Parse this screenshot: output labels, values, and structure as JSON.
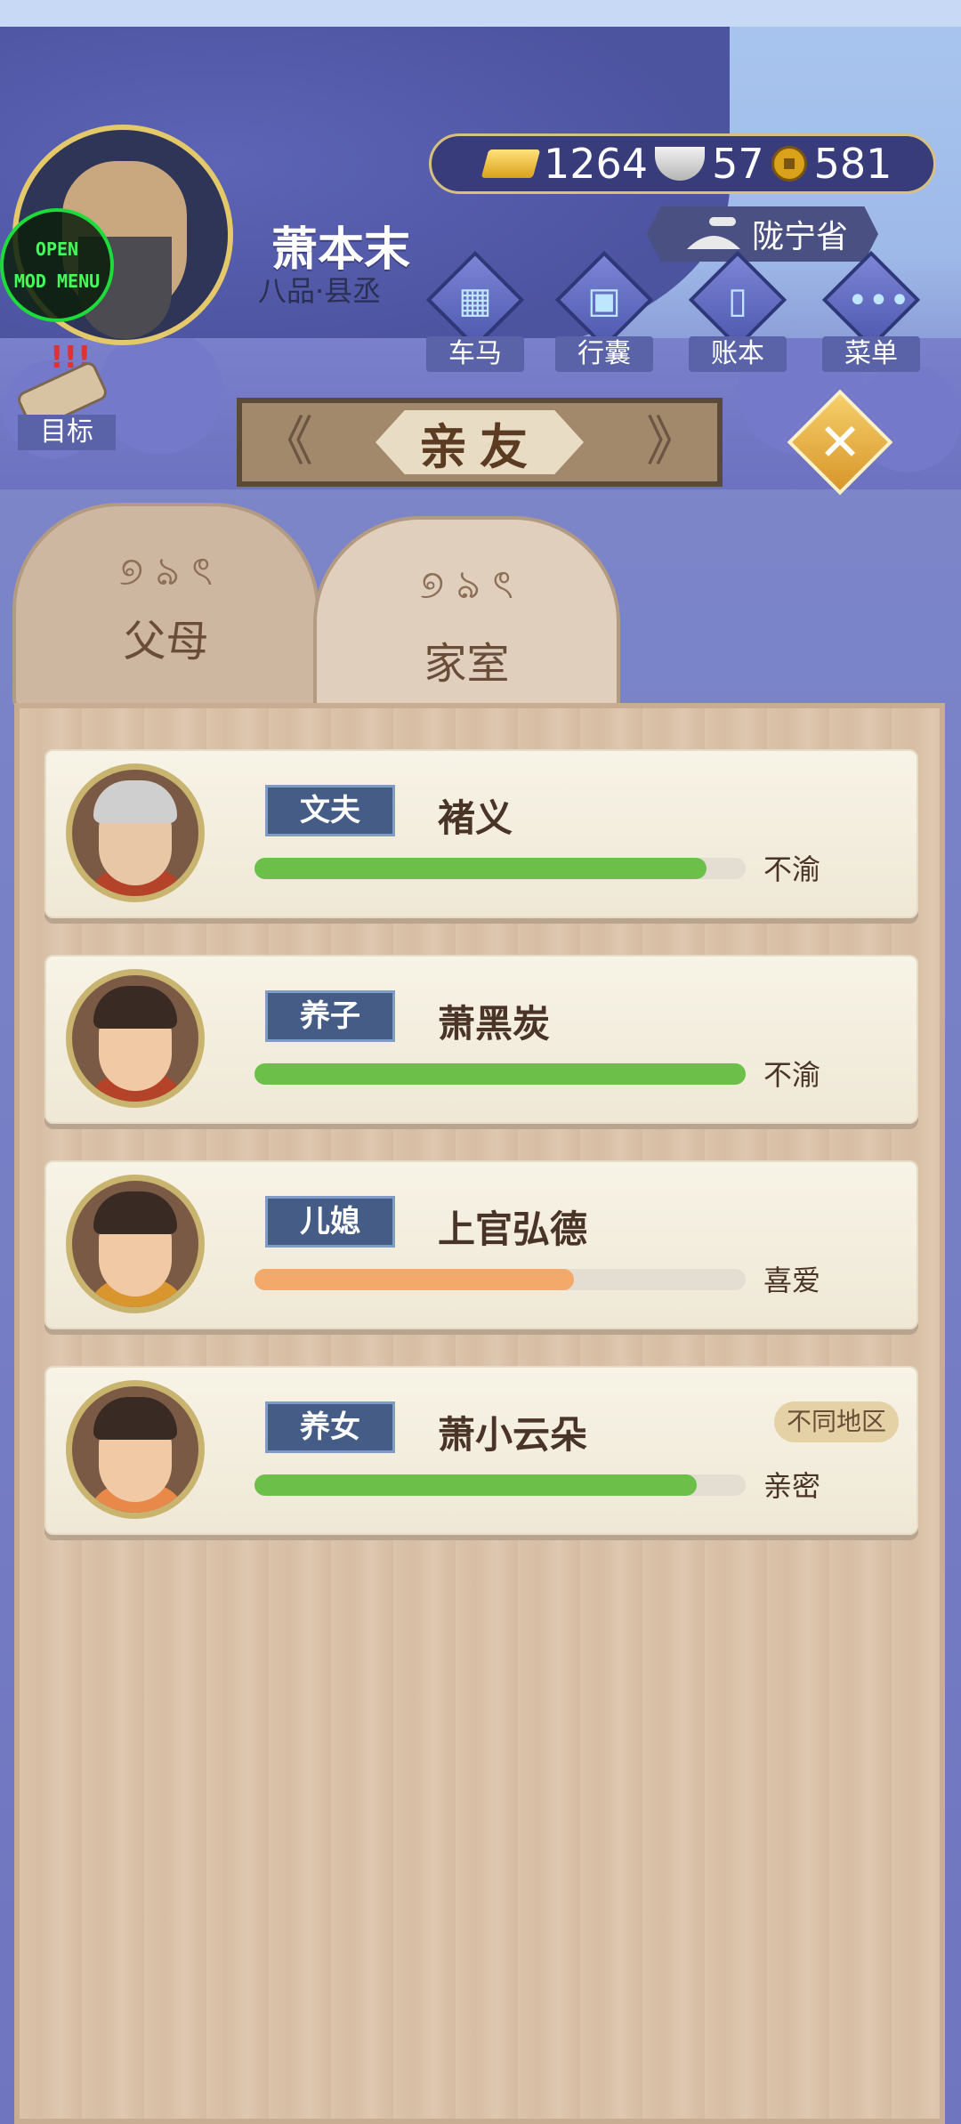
{
  "player": {
    "name": "萧本末",
    "rank": "八品·县丞"
  },
  "mod_menu": {
    "line1": "OPEN",
    "line2": "MOD MENU"
  },
  "currency": {
    "gold": "1264",
    "silver": "57",
    "coins": "581"
  },
  "province": "陇宁省",
  "menu": [
    {
      "label": "车马",
      "icon": "carriage-icon"
    },
    {
      "label": "行囊",
      "icon": "bag-icon"
    },
    {
      "label": "账本",
      "icon": "ledger-icon"
    },
    {
      "label": "菜单",
      "icon": "more-icon"
    }
  ],
  "target_label": "目标",
  "title": "亲友",
  "tabs": [
    {
      "label": "父母",
      "active": false
    },
    {
      "label": "家室",
      "active": true
    }
  ],
  "relatives": [
    {
      "relation": "文夫",
      "name": "褚义",
      "affinity": 0.92,
      "bar_color": "#6cc04a",
      "mood": "不渝",
      "badge": ""
    },
    {
      "relation": "养子",
      "name": "萧黑炭",
      "affinity": 1.0,
      "bar_color": "#6cc04a",
      "mood": "不渝",
      "badge": ""
    },
    {
      "relation": "儿媳",
      "name": "上官弘德",
      "affinity": 0.65,
      "bar_color": "#f2a96a",
      "mood": "喜爱",
      "badge": ""
    },
    {
      "relation": "养女",
      "name": "萧小云朵",
      "affinity": 0.9,
      "bar_color": "#6cc04a",
      "mood": "亲密",
      "badge": "不同地区"
    }
  ],
  "colors": {
    "banner": "#4c539f",
    "accent_gold": "#e3c96a",
    "tag_blue": "#445c86"
  }
}
